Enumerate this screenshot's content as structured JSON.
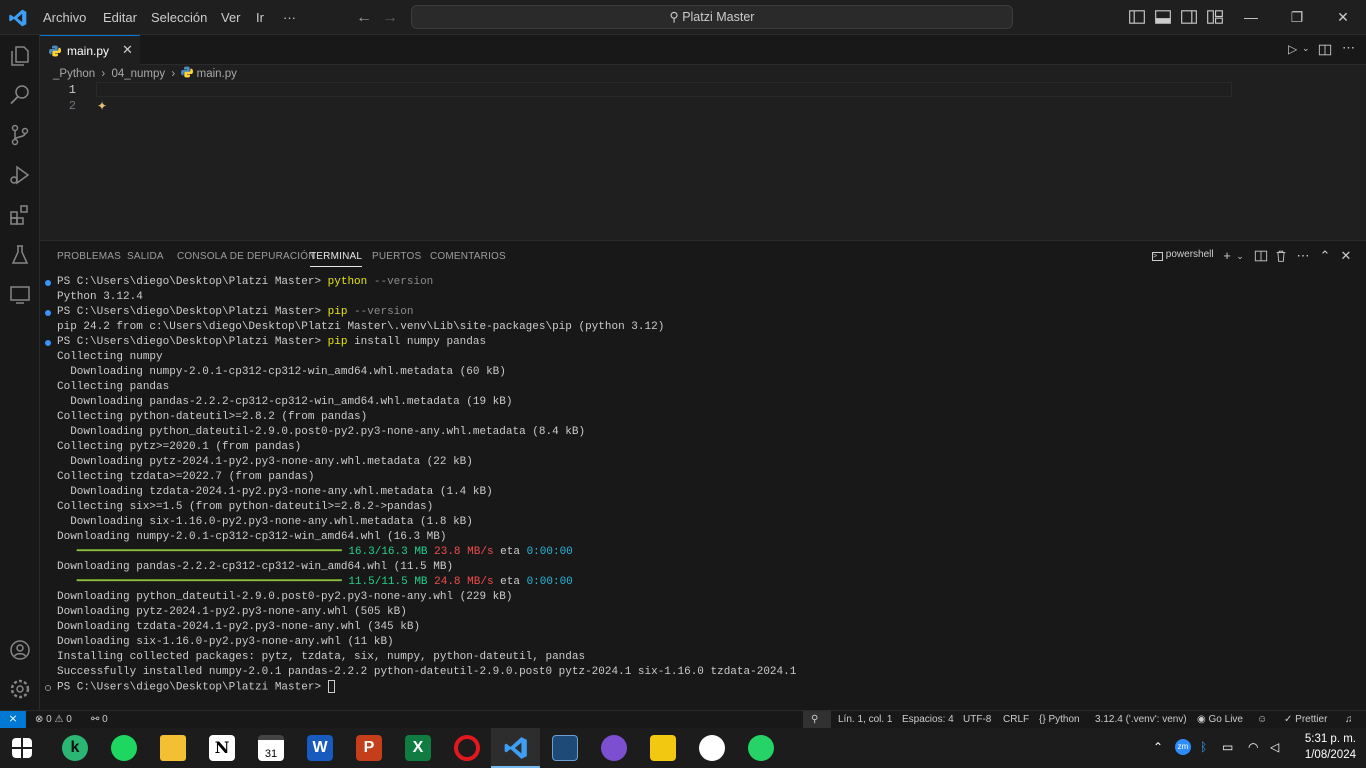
{
  "titlebar": {
    "menus": [
      "Archivo",
      "Editar",
      "Selección",
      "Ver",
      "Ir",
      "···"
    ],
    "search_text": "Platzi Master",
    "window_buttons": {
      "minimize": "—",
      "restore": "❐",
      "close": "✕"
    }
  },
  "editor": {
    "tab_label": "main.py",
    "tab_close": "✕",
    "breadcrumb": [
      "_Python",
      "04_numpy",
      "main.py"
    ],
    "breadcrumb_sep": "›",
    "line_numbers": [
      "1",
      "2"
    ],
    "sparkle": "✦"
  },
  "panel": {
    "tabs": [
      "PROBLEMAS",
      "SALIDA",
      "CONSOLA DE DEPURACIÓN",
      "TERMINAL",
      "PUERTOS",
      "COMENTARIOS"
    ],
    "active_tab": "TERMINAL",
    "shell_label": "powershell"
  },
  "terminal": {
    "prompt": "PS C:\\Users\\diego\\Desktop\\Platzi Master>",
    "lines": [
      {
        "dot": "blue",
        "parts": [
          {
            "t": "PS C:\\Users\\diego\\Desktop\\Platzi Master> ",
            "c": ""
          },
          {
            "t": "python",
            "c": "cmd-y"
          },
          {
            "t": " --version",
            "c": "flag"
          }
        ]
      },
      {
        "dot": "",
        "parts": [
          {
            "t": "Python 3.12.4",
            "c": ""
          }
        ]
      },
      {
        "dot": "blue",
        "parts": [
          {
            "t": "PS C:\\Users\\diego\\Desktop\\Platzi Master> ",
            "c": ""
          },
          {
            "t": "pip",
            "c": "cmd-y"
          },
          {
            "t": " --version",
            "c": "flag"
          }
        ]
      },
      {
        "dot": "",
        "parts": [
          {
            "t": "pip 24.2 from c:\\Users\\diego\\Desktop\\Platzi Master\\.venv\\Lib\\site-packages\\pip (python 3.12)",
            "c": ""
          }
        ]
      },
      {
        "dot": "blue",
        "parts": [
          {
            "t": "PS C:\\Users\\diego\\Desktop\\Platzi Master> ",
            "c": ""
          },
          {
            "t": "pip",
            "c": "cmd-y"
          },
          {
            "t": " install numpy pandas",
            "c": ""
          }
        ]
      },
      {
        "dot": "",
        "parts": [
          {
            "t": "Collecting numpy",
            "c": ""
          }
        ]
      },
      {
        "dot": "",
        "parts": [
          {
            "t": "  Downloading numpy-2.0.1-cp312-cp312-win_amd64.whl.metadata (60 kB)",
            "c": ""
          }
        ]
      },
      {
        "dot": "",
        "parts": [
          {
            "t": "Collecting pandas",
            "c": ""
          }
        ]
      },
      {
        "dot": "",
        "parts": [
          {
            "t": "  Downloading pandas-2.2.2-cp312-cp312-win_amd64.whl.metadata (19 kB)",
            "c": ""
          }
        ]
      },
      {
        "dot": "",
        "parts": [
          {
            "t": "Collecting python-dateutil>=2.8.2 (from pandas)",
            "c": ""
          }
        ]
      },
      {
        "dot": "",
        "parts": [
          {
            "t": "  Downloading python_dateutil-2.9.0.post0-py2.py3-none-any.whl.metadata (8.4 kB)",
            "c": ""
          }
        ]
      },
      {
        "dot": "",
        "parts": [
          {
            "t": "Collecting pytz>=2020.1 (from pandas)",
            "c": ""
          }
        ]
      },
      {
        "dot": "",
        "parts": [
          {
            "t": "  Downloading pytz-2024.1-py2.py3-none-any.whl.metadata (22 kB)",
            "c": ""
          }
        ]
      },
      {
        "dot": "",
        "parts": [
          {
            "t": "Collecting tzdata>=2022.7 (from pandas)",
            "c": ""
          }
        ]
      },
      {
        "dot": "",
        "parts": [
          {
            "t": "  Downloading tzdata-2024.1-py2.py3-none-any.whl.metadata (1.4 kB)",
            "c": ""
          }
        ]
      },
      {
        "dot": "",
        "parts": [
          {
            "t": "Collecting six>=1.5 (from python-dateutil>=2.8.2->pandas)",
            "c": ""
          }
        ]
      },
      {
        "dot": "",
        "parts": [
          {
            "t": "  Downloading six-1.16.0-py2.py3-none-any.whl.metadata (1.8 kB)",
            "c": ""
          }
        ]
      },
      {
        "dot": "",
        "parts": [
          {
            "t": "Downloading numpy-2.0.1-cp312-cp312-win_amd64.whl (16.3 MB)",
            "c": ""
          }
        ]
      },
      {
        "dot": "",
        "parts": [
          {
            "t": "   ━━━━━━━━━━━━━━━━━━━━━━━━━━━━━━━━━━━━━━━━ ",
            "c": "bar"
          },
          {
            "t": "16.3/16.3 MB",
            "c": "green"
          },
          {
            "t": " 23.8 MB/s",
            "c": "red"
          },
          {
            "t": " eta ",
            "c": ""
          },
          {
            "t": "0:00:00",
            "c": "cyan"
          }
        ]
      },
      {
        "dot": "",
        "parts": [
          {
            "t": "Downloading pandas-2.2.2-cp312-cp312-win_amd64.whl (11.5 MB)",
            "c": ""
          }
        ]
      },
      {
        "dot": "",
        "parts": [
          {
            "t": "   ━━━━━━━━━━━━━━━━━━━━━━━━━━━━━━━━━━━━━━━━ ",
            "c": "bar"
          },
          {
            "t": "11.5/11.5 MB",
            "c": "green"
          },
          {
            "t": " 24.8 MB/s",
            "c": "red"
          },
          {
            "t": " eta ",
            "c": ""
          },
          {
            "t": "0:00:00",
            "c": "cyan"
          }
        ]
      },
      {
        "dot": "",
        "parts": [
          {
            "t": "Downloading python_dateutil-2.9.0.post0-py2.py3-none-any.whl (229 kB)",
            "c": ""
          }
        ]
      },
      {
        "dot": "",
        "parts": [
          {
            "t": "Downloading pytz-2024.1-py2.py3-none-any.whl (505 kB)",
            "c": ""
          }
        ]
      },
      {
        "dot": "",
        "parts": [
          {
            "t": "Downloading tzdata-2024.1-py2.py3-none-any.whl (345 kB)",
            "c": ""
          }
        ]
      },
      {
        "dot": "",
        "parts": [
          {
            "t": "Downloading six-1.16.0-py2.py3-none-any.whl (11 kB)",
            "c": ""
          }
        ]
      },
      {
        "dot": "",
        "parts": [
          {
            "t": "Installing collected packages: pytz, tzdata, six, numpy, python-dateutil, pandas",
            "c": ""
          }
        ]
      },
      {
        "dot": "",
        "parts": [
          {
            "t": "Successfully installed numpy-2.0.1 pandas-2.2.2 python-dateutil-2.9.0.post0 pytz-2024.1 six-1.16.0 tzdata-2024.1",
            "c": ""
          }
        ]
      },
      {
        "dot": "hollow",
        "parts": [
          {
            "t": "PS C:\\Users\\diego\\Desktop\\Platzi Master> ",
            "c": ""
          }
        ],
        "cursor": true
      }
    ]
  },
  "statusbar": {
    "errors": "0",
    "warnings": "0",
    "ports": "0",
    "position": "Lín. 1, col. 1",
    "spaces": "Espacios: 4",
    "encoding": "UTF-8",
    "eol": "CRLF",
    "language": "Python",
    "interpreter": "3.12.4 ('.venv': venv)",
    "golive": "Go Live",
    "prettier": "Prettier"
  },
  "taskbar": {
    "apps": [
      "start",
      "kaspersky",
      "spotify",
      "file-explorer",
      "notion",
      "calendar",
      "word",
      "powerpoint",
      "excel",
      "opera",
      "vscode",
      "sql-developer",
      "github-desktop",
      "power-bi",
      "slack",
      "whatsapp"
    ],
    "tray_zoom": "zm",
    "time": "5:31 p. m.",
    "date": "1/08/2024"
  },
  "colors": {
    "accent": "#0078d4",
    "editor_bg": "#1f1f1f",
    "panel_bg": "#181818",
    "terminal_yellow": "#e5e510",
    "terminal_green": "#23d18b",
    "terminal_red": "#f14c4c",
    "terminal_cyan": "#29b8db"
  }
}
